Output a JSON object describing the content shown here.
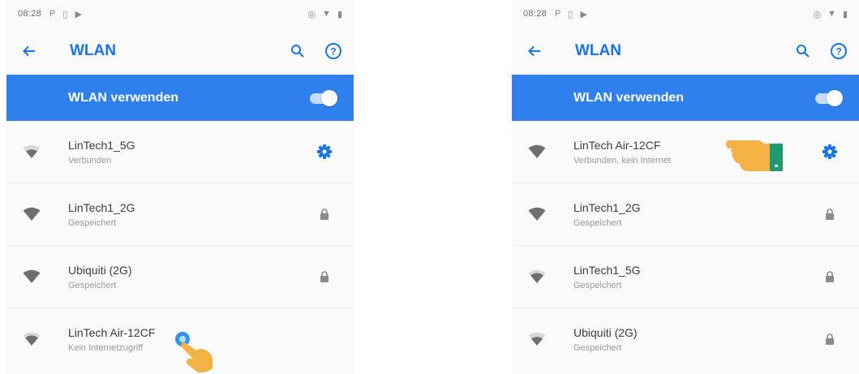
{
  "colors": {
    "accent": "#1a73e8",
    "master_bg": "#2f80ed",
    "hand": "#f4b245"
  },
  "left": {
    "status_time": "08:28",
    "title": "WLAN",
    "master_label": "WLAN verwenden",
    "master_on": true,
    "networks": [
      {
        "name": "LinTech1_5G",
        "status": "Verbunden",
        "trailing_icon": "gear-icon"
      },
      {
        "name": "LinTech1_2G",
        "status": "Gespeichert",
        "trailing_icon": "lock-icon"
      },
      {
        "name": "Ubiquiti (2G)",
        "status": "Gespeichert",
        "trailing_icon": "lock-icon"
      },
      {
        "name": "LinTech Air-12CF",
        "status": "Kein Internetzugriff",
        "trailing_icon": ""
      }
    ]
  },
  "right": {
    "status_time": "08:28",
    "title": "WLAN",
    "master_label": "WLAN verwenden",
    "master_on": true,
    "networks": [
      {
        "name": "LinTech Air-12CF",
        "status": "Verbunden, kein Internet",
        "trailing_icon": "gear-icon"
      },
      {
        "name": "LinTech1_2G",
        "status": "Gespeichert",
        "trailing_icon": "lock-icon"
      },
      {
        "name": "LinTech1_5G",
        "status": "Gespeichert",
        "trailing_icon": "lock-icon"
      },
      {
        "name": "Ubiquiti (2G)",
        "status": "Gespeichert",
        "trailing_icon": "lock-icon"
      }
    ]
  }
}
